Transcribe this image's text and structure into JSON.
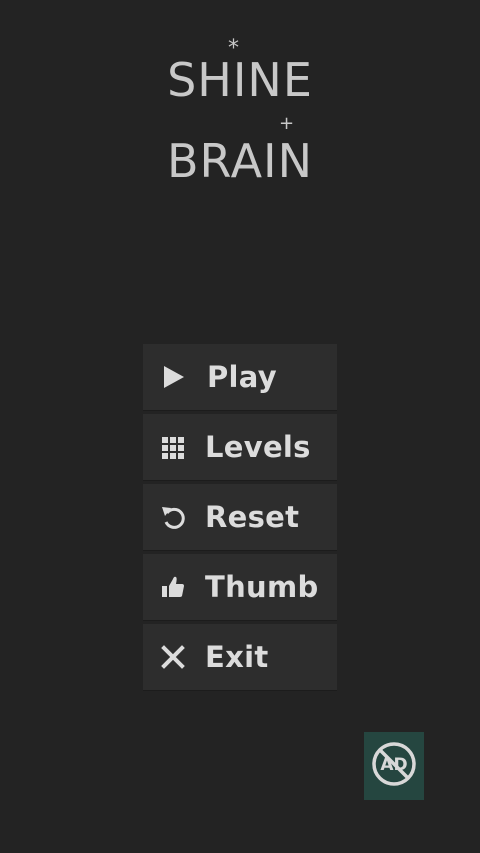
{
  "logo": {
    "line1": "SHINE",
    "line2": "BRAIN",
    "star": "*",
    "plus": "+"
  },
  "menu": [
    {
      "id": "play",
      "label": "Play",
      "icon": "play-icon"
    },
    {
      "id": "levels",
      "label": "Levels",
      "icon": "grid-icon"
    },
    {
      "id": "reset",
      "label": "Reset",
      "icon": "undo-icon"
    },
    {
      "id": "thumb",
      "label": "Thumb",
      "icon": "thumbs-up-icon"
    },
    {
      "id": "exit",
      "label": "Exit",
      "icon": "close-icon"
    }
  ],
  "ad_button": {
    "icon": "no-ads-icon",
    "text": "AD"
  },
  "colors": {
    "background": "#232323",
    "menu_item": "#2d2d2d",
    "text": "#dcdcdc",
    "logo": "#c8c8c8",
    "ad_button": "#254640"
  }
}
